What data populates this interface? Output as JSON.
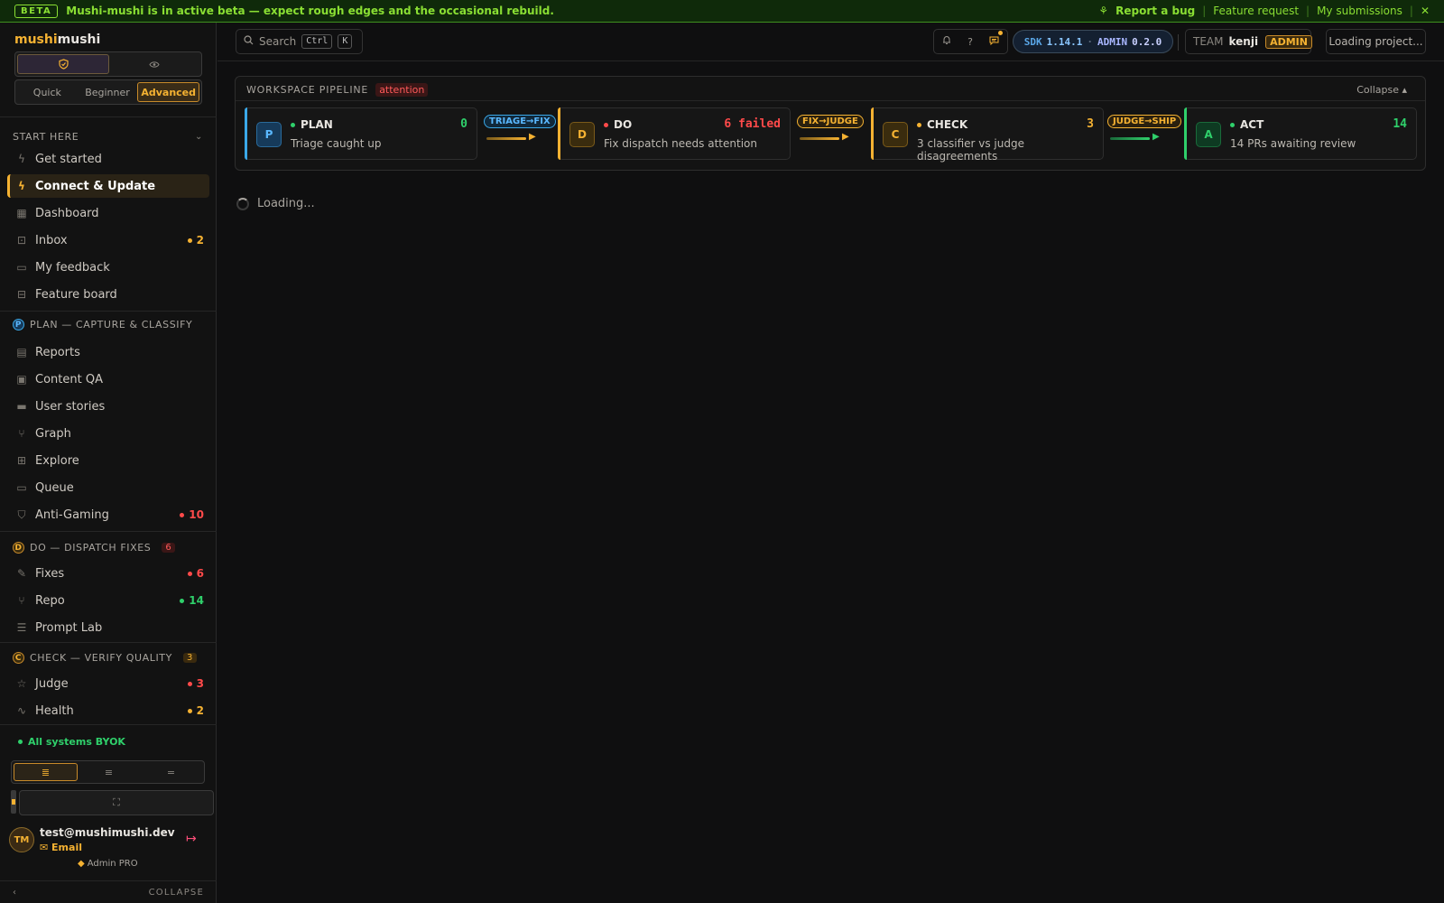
{
  "banner": {
    "tag": "BETA",
    "message": "Mushi-mushi is in active beta — expect rough edges and the occasional rebuild.",
    "report_bug": "Report a bug",
    "feature_request": "Feature request",
    "my_submissions": "My submissions",
    "sep": "|",
    "close": "✕",
    "bug_icon": "⚘"
  },
  "brand": {
    "part1": "mushi",
    "part2": "mushi"
  },
  "mode_toggle": {
    "a": "shield-icon",
    "b": "eye-icon"
  },
  "levels": [
    "Quick",
    "Beginner",
    "Advanced"
  ],
  "groups": {
    "start_here": "START HERE",
    "plan": {
      "letter": "P",
      "label": "PLAN — CAPTURE & CLASSIFY"
    },
    "do": {
      "letter": "D",
      "label": "DO — DISPATCH FIXES",
      "count": "6"
    },
    "check": {
      "letter": "C",
      "label": "CHECK — VERIFY QUALITY",
      "count": "3"
    }
  },
  "nav": {
    "get_started": "Get started",
    "connect_update": "Connect & Update",
    "dashboard": "Dashboard",
    "inbox": "Inbox",
    "inbox_count": "2",
    "my_feedback": "My feedback",
    "feature_board": "Feature board",
    "reports": "Reports",
    "content_qa": "Content QA",
    "user_stories": "User stories",
    "graph": "Graph",
    "explore": "Explore",
    "queue": "Queue",
    "anti_gaming": "Anti-Gaming",
    "anti_gaming_count": "10",
    "fixes": "Fixes",
    "fixes_count": "6",
    "repo": "Repo",
    "repo_count": "14",
    "prompt_lab": "Prompt Lab",
    "judge": "Judge",
    "judge_count": "3",
    "health": "Health",
    "health_count": "2"
  },
  "sidebar_footer": {
    "status": "All systems BYOK",
    "user_initials": "TM",
    "user_email": "test@mushimushi.dev",
    "auth_method": "Email",
    "plan": "Admin PRO",
    "collapse": "COLLAPSE"
  },
  "topbar": {
    "search": "Search",
    "kbd1": "Ctrl",
    "kbd2": "K",
    "help": "?",
    "sdk_label": "SDK",
    "sdk_version": "1.14.1",
    "admin_label": "ADMIN",
    "admin_version": "0.2.0",
    "team_label": "TEAM",
    "team_name": "kenji",
    "team_role": "ADMIN",
    "project": "Loading project..."
  },
  "pipeline": {
    "title": "WORKSPACE PIPELINE",
    "status": "attention",
    "collapse": "Collapse ▴",
    "stages": [
      {
        "letter": "P",
        "name": "PLAN",
        "count": "0",
        "desc": "Triage caught up",
        "color": "#3aa8e8",
        "dot": "#2fd06b"
      },
      {
        "letter": "D",
        "name": "DO",
        "count": "6 failed",
        "desc": "Fix dispatch needs attention",
        "color": "#f5b232",
        "dot": "#ff4a4a"
      },
      {
        "letter": "C",
        "name": "CHECK",
        "count": "3",
        "desc": "3 classifier vs judge disagreements",
        "color": "#f5b232",
        "dot": "#f5b232"
      },
      {
        "letter": "A",
        "name": "ACT",
        "count": "14",
        "desc": "14 PRs awaiting review",
        "color": "#2fd06b",
        "dot": "#2fd06b"
      }
    ],
    "connectors": [
      "TRIAGE→FIX",
      "FIX→JUDGE",
      "JUDGE→SHIP"
    ]
  },
  "loading": "Loading..."
}
